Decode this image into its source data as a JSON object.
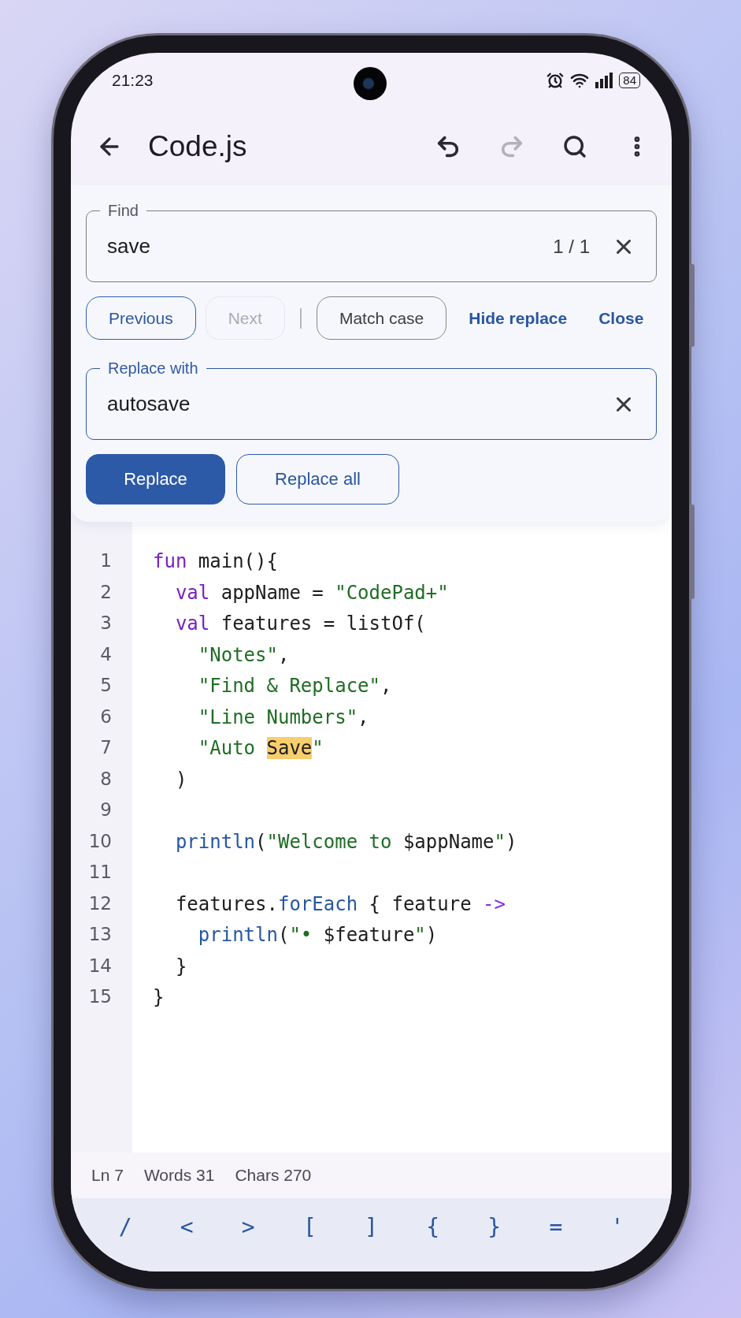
{
  "status_bar": {
    "time": "21:23",
    "battery": "84"
  },
  "top_bar": {
    "title": "Code.js",
    "actions": [
      {
        "kind": "undo",
        "disabled": false
      },
      {
        "kind": "redo",
        "disabled": true
      },
      {
        "kind": "search",
        "disabled": false
      },
      {
        "kind": "more",
        "disabled": false
      }
    ]
  },
  "find_panel": {
    "find_field": {
      "label": "Find",
      "value": "save",
      "count": "1 / 1",
      "focused": false
    },
    "actions": [
      {
        "kind": "outlined",
        "label": "Previous",
        "disabled": false
      },
      {
        "kind": "outlined",
        "label": "Next",
        "disabled": true
      },
      {
        "kind": "separator"
      },
      {
        "kind": "toggle",
        "label": "Match case",
        "disabled": false
      },
      {
        "kind": "text",
        "label": "Hide replace",
        "disabled": false
      },
      {
        "kind": "text",
        "label": "Close",
        "disabled": false
      }
    ],
    "replace_field": {
      "label": "Replace with",
      "value": "autosave",
      "focused": true
    },
    "replace_actions": [
      {
        "kind": "filled",
        "label": "Replace"
      },
      {
        "kind": "outlined",
        "label": "Replace all"
      }
    ]
  },
  "editor": {
    "lines": [
      {
        "number": "1",
        "tokens": [
          {
            "kind": "keyword",
            "text": "fun"
          },
          {
            "kind": "plain",
            "text": " main(){"
          }
        ]
      },
      {
        "number": "2",
        "tokens": [
          {
            "kind": "keyword",
            "text": "  val"
          },
          {
            "kind": "plain",
            "text": " appName = "
          },
          {
            "kind": "string",
            "text": "\"CodePad+\""
          }
        ]
      },
      {
        "number": "3",
        "tokens": [
          {
            "kind": "keyword",
            "text": "  val"
          },
          {
            "kind": "plain",
            "text": " features = listOf("
          }
        ]
      },
      {
        "number": "4",
        "tokens": [
          {
            "kind": "string",
            "text": "    \"Notes\""
          },
          {
            "kind": "plain",
            "text": ","
          }
        ]
      },
      {
        "number": "5",
        "tokens": [
          {
            "kind": "string",
            "text": "    \"Find & Replace\""
          },
          {
            "kind": "plain",
            "text": ","
          }
        ]
      },
      {
        "number": "6",
        "tokens": [
          {
            "kind": "string",
            "text": "    \"Line Numbers\""
          },
          {
            "kind": "plain",
            "text": ","
          }
        ]
      },
      {
        "number": "7",
        "tokens": [
          {
            "kind": "string",
            "text": "    \"Auto "
          },
          {
            "kind": "match",
            "text": "Save"
          },
          {
            "kind": "string",
            "text": "\""
          }
        ]
      },
      {
        "number": "8",
        "tokens": [
          {
            "kind": "plain",
            "text": "  )"
          }
        ]
      },
      {
        "number": "9"
      },
      {
        "number": "10",
        "tokens": [
          {
            "kind": "function",
            "text": "  println"
          },
          {
            "kind": "plain",
            "text": "("
          },
          {
            "kind": "string",
            "text": "\"Welcome to "
          },
          {
            "kind": "plain",
            "text": "$appName"
          },
          {
            "kind": "string",
            "text": "\""
          },
          {
            "kind": "plain",
            "text": ")"
          }
        ]
      },
      {
        "number": "11"
      },
      {
        "number": "12",
        "tokens": [
          {
            "kind": "plain",
            "text": "  features."
          },
          {
            "kind": "function",
            "text": "forEach"
          },
          {
            "kind": "plain",
            "text": " { feature "
          },
          {
            "kind": "operator",
            "text": "->"
          }
        ]
      },
      {
        "number": "13",
        "tokens": [
          {
            "kind": "function",
            "text": "    println"
          },
          {
            "kind": "plain",
            "text": "("
          },
          {
            "kind": "string",
            "text": "\"• "
          },
          {
            "kind": "plain",
            "text": "$feature"
          },
          {
            "kind": "string",
            "text": "\""
          },
          {
            "kind": "plain",
            "text": ")"
          }
        ]
      },
      {
        "number": "14",
        "tokens": [
          {
            "kind": "plain",
            "text": "  }"
          }
        ]
      },
      {
        "number": "15",
        "tokens": [
          {
            "kind": "plain",
            "text": "}"
          }
        ]
      }
    ]
  },
  "footer": {
    "stats": [
      "Ln 7",
      "Words 31",
      "Chars 270"
    ]
  },
  "key_bar": {
    "keys": [
      "/",
      "<",
      ">",
      "[",
      "]",
      "{",
      "}",
      "=",
      "'"
    ]
  }
}
